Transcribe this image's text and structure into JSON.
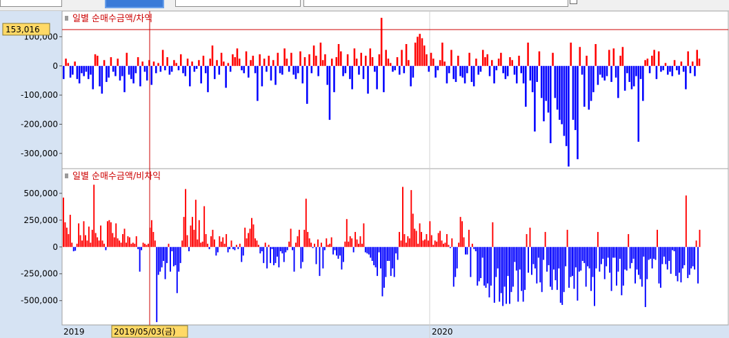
{
  "colors": {
    "positive": "#ff0000",
    "negative": "#0000ff",
    "cursor": "#cc0000",
    "cursor_label_bg": "#ffd966",
    "axis_bg": "#d6e3f3"
  },
  "chart_data": [
    {
      "type": "bar",
      "title": "일별 순매수금액/차익",
      "ylim": [
        -350000,
        160000
      ],
      "yticks": [
        "100,000",
        "0",
        "-100,000",
        "-200,000",
        "-300,000"
      ],
      "ytick_values": [
        100000,
        0,
        -100000,
        -200000,
        -300000
      ],
      "cursor_value": "153,016",
      "values": [
        -45000,
        25000,
        10000,
        -40000,
        -30000,
        15000,
        -45000,
        -60000,
        -25000,
        -35000,
        -20000,
        -45000,
        -30000,
        -80000,
        40000,
        35000,
        -70000,
        -95000,
        20000,
        -55000,
        -40000,
        30000,
        -20000,
        -35000,
        25000,
        -50000,
        -35000,
        -90000,
        45000,
        -30000,
        -45000,
        -60000,
        -25000,
        30000,
        -70000,
        15000,
        -20000,
        -50000,
        20000,
        -65000,
        15000,
        -25000,
        10000,
        -20000,
        55000,
        -15000,
        30000,
        -30000,
        -20000,
        20000,
        10000,
        -15000,
        40000,
        -25000,
        -35000,
        25000,
        -70000,
        15000,
        -20000,
        -10000,
        20000,
        -60000,
        35000,
        -25000,
        -90000,
        25000,
        70000,
        -45000,
        20000,
        -30000,
        45000,
        15000,
        -75000,
        10000,
        -20000,
        40000,
        30000,
        60000,
        25000,
        -15000,
        -25000,
        50000,
        -40000,
        20000,
        35000,
        -25000,
        -120000,
        40000,
        -70000,
        25000,
        -20000,
        35000,
        -50000,
        20000,
        -65000,
        45000,
        -25000,
        -30000,
        60000,
        25000,
        -20000,
        45000,
        -30000,
        -45000,
        -25000,
        50000,
        -60000,
        30000,
        -130000,
        40000,
        -25000,
        70000,
        35000,
        -35000,
        80000,
        20000,
        40000,
        -65000,
        -185000,
        25000,
        -90000,
        30000,
        75000,
        50000,
        -35000,
        -25000,
        40000,
        -45000,
        -80000,
        60000,
        25000,
        -30000,
        45000,
        -45000,
        35000,
        -95000,
        60000,
        30000,
        -20000,
        -80000,
        40000,
        165000,
        -90000,
        55000,
        25000,
        10000,
        -20000,
        -15000,
        30000,
        -30000,
        55000,
        -25000,
        75000,
        20000,
        -70000,
        -40000,
        80000,
        100000,
        110000,
        95000,
        70000,
        40000,
        -20000,
        45000,
        25000,
        -40000,
        -15000,
        20000,
        80000,
        15000,
        -60000,
        -25000,
        55000,
        -45000,
        -55000,
        35000,
        -35000,
        -40000,
        -60000,
        -25000,
        45000,
        -55000,
        -70000,
        25000,
        -30000,
        -20000,
        55000,
        30000,
        40000,
        -35000,
        20000,
        -60000,
        -15000,
        25000,
        45000,
        -25000,
        -45000,
        -35000,
        30000,
        20000,
        -30000,
        -60000,
        35000,
        -25000,
        -60000,
        -140000,
        80000,
        -50000,
        -90000,
        -225000,
        -55000,
        50000,
        -110000,
        -190000,
        -120000,
        -160000,
        -265000,
        45000,
        -110000,
        -150000,
        -185000,
        -200000,
        -240000,
        -275000,
        -345000,
        80000,
        -185000,
        -220000,
        -320000,
        65000,
        -30000,
        -140000,
        35000,
        -150000,
        -120000,
        -90000,
        75000,
        -65000,
        -30000,
        -40000,
        -50000,
        -35000,
        55000,
        -55000,
        60000,
        -40000,
        -110000,
        35000,
        65000,
        -85000,
        -25000,
        -55000,
        -80000,
        -70000,
        -35000,
        -260000,
        -45000,
        -120000,
        20000,
        25000,
        -25000,
        35000,
        55000,
        -45000,
        50000,
        -20000,
        -15000,
        10000,
        -30000,
        -20000,
        -35000,
        20000,
        -15000,
        -30000,
        15000,
        -20000,
        -80000,
        50000,
        -25000,
        15000,
        -35000,
        55000,
        25000
      ]
    },
    {
      "type": "bar",
      "title": "일별 순매수금액/비차익",
      "ylim": [
        -720000,
        640000
      ],
      "yticks": [
        "500,000",
        "250,000",
        "0",
        "-250,000",
        "-500,000"
      ],
      "ytick_values": [
        500000,
        250000,
        0,
        -250000,
        -500000
      ],
      "x_labels": [
        "2019",
        "2020"
      ],
      "cursor_date": "2019/05/03(금)",
      "values": [
        460000,
        230000,
        180000,
        120000,
        300000,
        40000,
        -40000,
        -35000,
        30000,
        220000,
        110000,
        60000,
        240000,
        110000,
        60000,
        190000,
        40000,
        160000,
        580000,
        130000,
        90000,
        60000,
        200000,
        60000,
        30000,
        -30000,
        240000,
        250000,
        230000,
        130000,
        90000,
        220000,
        80000,
        60000,
        40000,
        120000,
        170000,
        40000,
        100000,
        90000,
        30000,
        40000,
        30000,
        100000,
        -20000,
        -230000,
        -30000,
        40000,
        30000,
        20000,
        30000,
        180000,
        250000,
        140000,
        60000,
        -700000,
        -260000,
        -230000,
        -190000,
        -130000,
        -300000,
        -150000,
        30000,
        -230000,
        -40000,
        -180000,
        -170000,
        -430000,
        -230000,
        -150000,
        60000,
        280000,
        540000,
        110000,
        -40000,
        200000,
        280000,
        160000,
        440000,
        70000,
        250000,
        40000,
        50000,
        380000,
        120000,
        30000,
        -20000,
        100000,
        160000,
        70000,
        -80000,
        -50000,
        100000,
        50000,
        90000,
        30000,
        120000,
        -50000,
        -20000,
        60000,
        -20000,
        -30000,
        20000,
        -20000,
        30000,
        -140000,
        -80000,
        180000,
        80000,
        130000,
        170000,
        270000,
        210000,
        80000,
        60000,
        20000,
        -60000,
        -40000,
        -150000,
        40000,
        -200000,
        20000,
        -150000,
        -20000,
        -170000,
        -150000,
        -90000,
        -190000,
        -40000,
        -60000,
        -140000,
        -50000,
        -30000,
        50000,
        170000,
        -30000,
        -230000,
        40000,
        100000,
        160000,
        -200000,
        -140000,
        160000,
        450000,
        140000,
        80000,
        40000,
        -10000,
        30000,
        -160000,
        70000,
        -270000,
        40000,
        -200000,
        -30000,
        80000,
        20000,
        30000,
        90000,
        -70000,
        -30000,
        -80000,
        -110000,
        -80000,
        -210000,
        -140000,
        50000,
        260000,
        50000,
        100000,
        80000,
        -50000,
        140000,
        70000,
        30000,
        100000,
        30000,
        220000,
        -50000,
        -60000,
        -70000,
        -100000,
        -130000,
        -170000,
        -190000,
        -270000,
        -50000,
        -200000,
        -460000,
        -380000,
        -280000,
        -130000,
        -130000,
        -270000,
        -200000,
        -280000,
        -60000,
        -120000,
        140000,
        60000,
        560000,
        120000,
        40000,
        100000,
        80000,
        530000,
        310000,
        170000,
        150000,
        30000,
        220000,
        140000,
        60000,
        70000,
        120000,
        60000,
        240000,
        110000,
        20000,
        60000,
        50000,
        130000,
        150000,
        60000,
        30000,
        40000,
        120000,
        20000,
        -10000,
        80000,
        -370000,
        -280000,
        -200000,
        40000,
        280000,
        240000,
        90000,
        -70000,
        -70000,
        160000,
        -280000,
        30000,
        -20000,
        -40000,
        -360000,
        -320000,
        -290000,
        -100000,
        -360000,
        -380000,
        -340000,
        -470000,
        -360000,
        230000,
        -520000,
        -280000,
        -200000,
        -510000,
        -430000,
        -550000,
        -370000,
        -530000,
        -270000,
        -530000,
        -420000,
        -370000,
        -140000,
        -220000,
        -510000,
        -210000,
        -410000,
        -510000,
        -400000,
        120000,
        -240000,
        180000,
        -260000,
        -160000,
        -200000,
        -340000,
        -100000,
        -330000,
        -420000,
        -120000,
        140000,
        -230000,
        -170000,
        -370000,
        -400000,
        -210000,
        -310000,
        -400000,
        -200000,
        -520000,
        -540000,
        -420000,
        -180000,
        160000,
        -380000,
        -280000,
        -270000,
        -390000,
        -190000,
        -500000,
        -230000,
        -220000,
        -130000,
        -150000,
        -370000,
        -180000,
        -200000,
        -410000,
        -280000,
        -550000,
        -200000,
        140000,
        -230000,
        -160000,
        -110000,
        -300000,
        -180000,
        -100000,
        -240000,
        -410000,
        -100000,
        -100000,
        -360000,
        -230000,
        -110000,
        -450000,
        -360000,
        -210000,
        -220000,
        120000,
        -200000,
        -150000,
        -110000,
        -340000,
        -210000,
        -260000,
        -300000,
        -370000,
        -90000,
        -560000,
        -300000,
        -120000,
        -110000,
        -200000,
        -110000,
        -120000,
        160000,
        -340000,
        -380000,
        -160000,
        -90000,
        -160000,
        -210000,
        -130000,
        -250000,
        -30000,
        -40000,
        -270000,
        -320000,
        -240000,
        -330000,
        -200000,
        -170000,
        480000,
        -290000,
        -260000,
        -200000,
        -180000,
        -210000,
        60000,
        -340000,
        160000
      ]
    }
  ]
}
